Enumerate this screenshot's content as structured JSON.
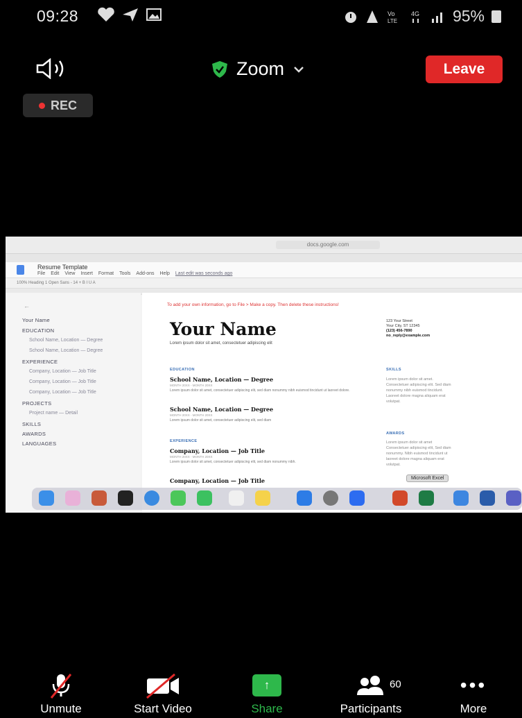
{
  "status_bar": {
    "time": "09:28",
    "battery": "95%",
    "left_icons": [
      "heart-icon",
      "send-icon",
      "image-icon"
    ],
    "right_icons": [
      "alarm-icon",
      "signal-icon",
      "volte-icon",
      "4g-icon",
      "bars-icon"
    ]
  },
  "top_bar": {
    "title": "Zoom",
    "leave_label": "Leave",
    "rec_label": "REC",
    "icons": {
      "speaker": "speaker-icon",
      "security": "shield-check-icon",
      "menu": "chevron-down-icon"
    }
  },
  "shared_screen": {
    "url": "docs.google.com",
    "tabs": [
      "",
      ""
    ],
    "doc": {
      "title": "Resume Template",
      "menu": [
        "File",
        "Edit",
        "View",
        "Insert",
        "Format",
        "Tools",
        "Add-ons",
        "Help"
      ],
      "last_edit": "Last edit was seconds ago",
      "toolbar_text": "100%   Heading 1   Open Sans   -   14   +   B   I   U   A",
      "red_note": "To add your own information, go to File > Make a copy. Then delete these instructions!",
      "outline": {
        "items": [
          {
            "text": "Your Name",
            "level": "h"
          },
          {
            "text": "EDUCATION",
            "level": "h"
          },
          {
            "text": "School Name, Location — Degree",
            "level": "sub"
          },
          {
            "text": "School Name, Location — Degree",
            "level": "sub"
          },
          {
            "text": "EXPERIENCE",
            "level": "h"
          },
          {
            "text": "Company, Location — Job Title",
            "level": "sub"
          },
          {
            "text": "Company, Location — Job Title",
            "level": "sub"
          },
          {
            "text": "Company, Location — Job Title",
            "level": "sub"
          },
          {
            "text": "PROJECTS",
            "level": "h"
          },
          {
            "text": "Project name — Detail",
            "level": "sub"
          },
          {
            "text": "SKILLS",
            "level": "h"
          },
          {
            "text": "AWARDS",
            "level": "h"
          },
          {
            "text": "LANGUAGES",
            "level": "h"
          }
        ]
      },
      "page": {
        "name": "Your Name",
        "name_sub": "Lorem ipsum dolor sit amet, consectetuer adipiscing elit",
        "contact": [
          "123 Your Street",
          "Your City, ST 12345",
          "(123) 456-7890",
          "no_reply@example.com"
        ],
        "education_head": "EDUCATION",
        "experience_head": "EXPERIENCE",
        "skills_head": "SKILLS",
        "awards_head": "AWARDS",
        "school1": "School Name, Location — Degree",
        "school2": "School Name, Location — Degree",
        "company1": "Company, Location — Job Title",
        "company2": "Company, Location — Job Title",
        "meta": "MONTH 20XX - MONTH 20XX",
        "lorem1": "Lorem ipsum dolor sit amet, consectetuer adipiscing elit, sed diam nonummy nibh euismod tincidunt ut laoreet dolore.",
        "lorem2": "Lorem ipsum dolor sit amet, consectetuer adipiscing elit, sed diam",
        "lorem3": "Lorem ipsum dolor sit amet, consectetuer adipiscing elit, sed diam nonummy nibh.",
        "skills_text": "Lorem ipsum dolor sit amet. Consectetuer adipiscing elit. Sed diam nonummy nibh euismod tincidunt. Laoreet dolore magna aliquam erat volutpat.",
        "awards_text": "Lorem ipsum dolor sit amet Consectetuer adipiscing elit, Sed diam nonummy. Nibh euismod tincidunt ut laoreet dolore magna aliquam erat volutpat."
      }
    },
    "dock_tooltip": "Microsoft Excel",
    "dock_icons": [
      "finder-icon",
      "photos-icon",
      "launchpad-icon",
      "piano-icon",
      "safari-icon",
      "messages-icon",
      "facetime-icon",
      "calendar-icon",
      "notes-icon",
      "appstore-icon",
      "settings-icon",
      "zoom-icon",
      "powerpoint-icon",
      "excel-icon",
      "mail-icon",
      "word-icon",
      "teams-icon"
    ]
  },
  "bottom_bar": {
    "unmute": "Unmute",
    "start_video": "Start Video",
    "share": "Share",
    "participants": "Participants",
    "participant_count": "60",
    "more": "More"
  },
  "colors": {
    "leave": "#e02828",
    "share": "#2eb84b",
    "rec_dot": "#e33333",
    "shield": "#2eb84b"
  }
}
